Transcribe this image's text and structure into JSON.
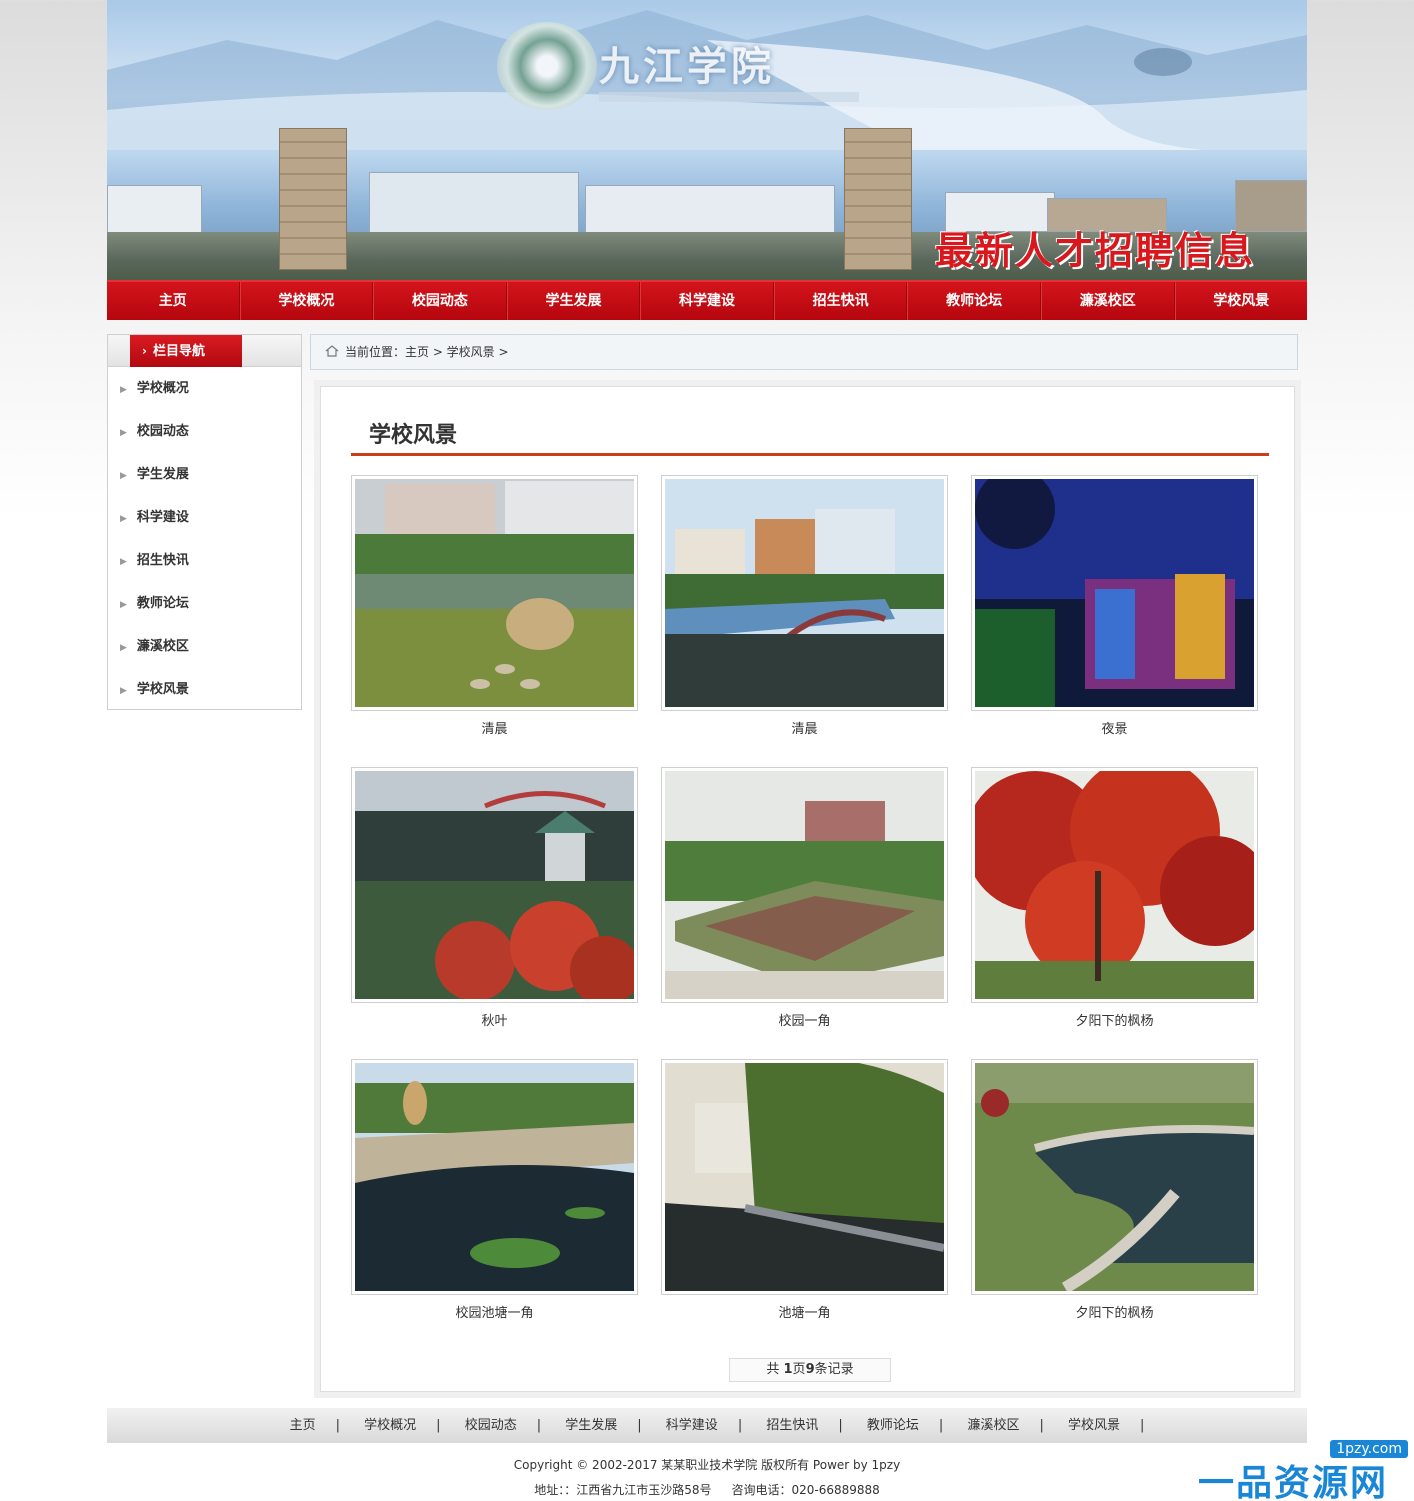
{
  "banner": {
    "logo_text": "九江学院",
    "recruit_text": "最新人才招聘信息"
  },
  "nav": [
    "主页",
    "学校概况",
    "校园动态",
    "学生发展",
    "科学建设",
    "招生快讯",
    "教师论坛",
    "濂溪校区",
    "学校风景"
  ],
  "sidebar": {
    "title": "栏目导航",
    "items": [
      "学校概况",
      "校园动态",
      "学生发展",
      "科学建设",
      "招生快讯",
      "教师论坛",
      "濂溪校区",
      "学校风景"
    ]
  },
  "breadcrumb": {
    "text": "当前位置：主页 > 学校风景 >"
  },
  "page_title": "学校风景",
  "gallery": [
    {
      "caption": "清晨",
      "scene": "lake-rock"
    },
    {
      "caption": "清晨",
      "scene": "bridge"
    },
    {
      "caption": "夜景",
      "scene": "night"
    },
    {
      "caption": "秋叶",
      "scene": "pavilion"
    },
    {
      "caption": "校园一角",
      "scene": "garden"
    },
    {
      "caption": "夕阳下的枫杨",
      "scene": "maple"
    },
    {
      "caption": "校园池塘一角",
      "scene": "pond"
    },
    {
      "caption": "池塘一角",
      "scene": "willow"
    },
    {
      "caption": "夕阳下的枫杨",
      "scene": "walkway"
    }
  ],
  "pager": {
    "prefix": "共 ",
    "pages": "1",
    "mid": "页",
    "records": "9",
    "suffix": "条记录"
  },
  "footer": {
    "nav": [
      "主页",
      "学校概况",
      "校园动态",
      "学生发展",
      "科学建设",
      "招生快讯",
      "教师论坛",
      "濂溪校区",
      "学校风景"
    ],
    "copyright": "Copyright © 2002-2017 某某职业技术学院 版权所有 Power by 1pzy",
    "address": "地址：：江西省九江市玉沙路58号",
    "phone": "咨询电话：020-66889888"
  },
  "watermark": {
    "url": "1pzy.com",
    "text": "一品资源网"
  },
  "colors": {
    "nav_red": "#c40c13",
    "title_line": "#c8401a",
    "watermark_blue": "#1a86d6"
  }
}
